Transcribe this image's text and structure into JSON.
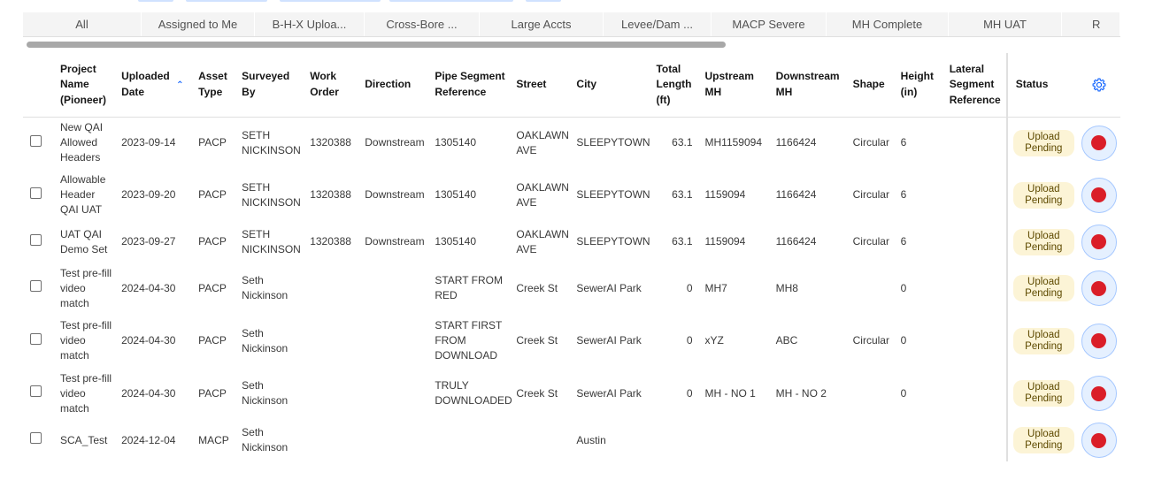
{
  "tabs": [
    "All",
    "Assigned to Me",
    "B-H-X Uploa...",
    "Cross-Bore ...",
    "Large Accts",
    "Levee/Dam ...",
    "MACP Severe",
    "MH Complete",
    "MH UAT",
    "R"
  ],
  "columns": {
    "project_name": "Project Name (Pioneer)",
    "uploaded_date": "Uploaded Date",
    "asset_type": "Asset Type",
    "surveyed_by": "Surveyed By",
    "work_order": "Work Order",
    "direction": "Direction",
    "pipe_segment_reference": "Pipe Segment Reference",
    "street": "Street",
    "city": "City",
    "total_length": "Total Length (ft)",
    "upstream_mh": "Upstream MH",
    "downstream_mh": "Downstream MH",
    "shape": "Shape",
    "height": "Height (in)",
    "lateral_segment_reference": "Lateral Segment Reference",
    "status": "Status",
    "settings_icon": "gear-icon"
  },
  "sort": {
    "column": "uploaded_date",
    "direction": "ascending",
    "icon": "chevron-up-icon"
  },
  "rows": [
    {
      "project_name": "New QAI Allowed Headers",
      "uploaded_date": "2023-09-14",
      "asset_type": "PACP",
      "surveyed_by": "SETH NICKINSON",
      "work_order": "1320388",
      "direction": "Downstream",
      "pipe_segment_reference": "1305140",
      "street": "OAKLAWN AVE",
      "city": "SLEEPYTOWN",
      "total_length": "63.1",
      "upstream_mh": "MH1159094",
      "downstream_mh": "1166424",
      "shape": "Circular",
      "height": "6",
      "lateral_segment_reference": "",
      "status": "Upload Pending"
    },
    {
      "project_name": "Allowable Header QAI UAT",
      "uploaded_date": "2023-09-20",
      "asset_type": "PACP",
      "surveyed_by": "SETH NICKINSON",
      "work_order": "1320388",
      "direction": "Downstream",
      "pipe_segment_reference": "1305140",
      "street": "OAKLAWN AVE",
      "city": "SLEEPYTOWN",
      "total_length": "63.1",
      "upstream_mh": "1159094",
      "downstream_mh": "1166424",
      "shape": "Circular",
      "height": "6",
      "lateral_segment_reference": "",
      "status": "Upload Pending"
    },
    {
      "project_name": "UAT QAI Demo Set",
      "uploaded_date": "2023-09-27",
      "asset_type": "PACP",
      "surveyed_by": "SETH NICKINSON",
      "work_order": "1320388",
      "direction": "Downstream",
      "pipe_segment_reference": "1305140",
      "street": "OAKLAWN AVE",
      "city": "SLEEPYTOWN",
      "total_length": "63.1",
      "upstream_mh": "1159094",
      "downstream_mh": "1166424",
      "shape": "Circular",
      "height": "6",
      "lateral_segment_reference": "",
      "status": "Upload Pending"
    },
    {
      "project_name": "Test pre-fill video match",
      "uploaded_date": "2024-04-30",
      "asset_type": "PACP",
      "surveyed_by": "Seth Nickinson",
      "work_order": "",
      "direction": "",
      "pipe_segment_reference": "START FROM RED",
      "street": "Creek St",
      "city": "SewerAI Park",
      "total_length": "0",
      "upstream_mh": "MH7",
      "downstream_mh": "MH8",
      "shape": "",
      "height": "0",
      "lateral_segment_reference": "",
      "status": "Upload Pending"
    },
    {
      "project_name": "Test pre-fill video match",
      "uploaded_date": "2024-04-30",
      "asset_type": "PACP",
      "surveyed_by": "Seth Nickinson",
      "work_order": "",
      "direction": "",
      "pipe_segment_reference": "START FIRST FROM DOWNLOAD",
      "street": "Creek St",
      "city": "SewerAI Park",
      "total_length": "0",
      "upstream_mh": "xYZ",
      "downstream_mh": "ABC",
      "shape": "Circular",
      "height": "0",
      "lateral_segment_reference": "",
      "status": "Upload Pending"
    },
    {
      "project_name": "Test pre-fill video match",
      "uploaded_date": "2024-04-30",
      "asset_type": "PACP",
      "surveyed_by": "Seth Nickinson",
      "work_order": "",
      "direction": "",
      "pipe_segment_reference": "TRULY DOWNLOADED",
      "street": "Creek St",
      "city": "SewerAI Park",
      "total_length": "0",
      "upstream_mh": "MH - NO 1",
      "downstream_mh": "MH - NO 2",
      "shape": "",
      "height": "0",
      "lateral_segment_reference": "",
      "status": "Upload Pending"
    },
    {
      "project_name": "SCA_Test",
      "uploaded_date": "2024-12-04",
      "asset_type": "MACP",
      "surveyed_by": "Seth Nickinson",
      "work_order": "",
      "direction": "",
      "pipe_segment_reference": "",
      "street": "",
      "city": "Austin",
      "total_length": "",
      "upstream_mh": "",
      "downstream_mh": "",
      "shape": "",
      "height": "",
      "lateral_segment_reference": "",
      "status": "Upload Pending"
    }
  ],
  "row_action_icon": "record-icon",
  "colors": {
    "accent": "#0f62fe",
    "badge_bg": "#fcf4d6",
    "record_red": "#da1e28",
    "record_btn_bg": "#e5f0ff"
  }
}
